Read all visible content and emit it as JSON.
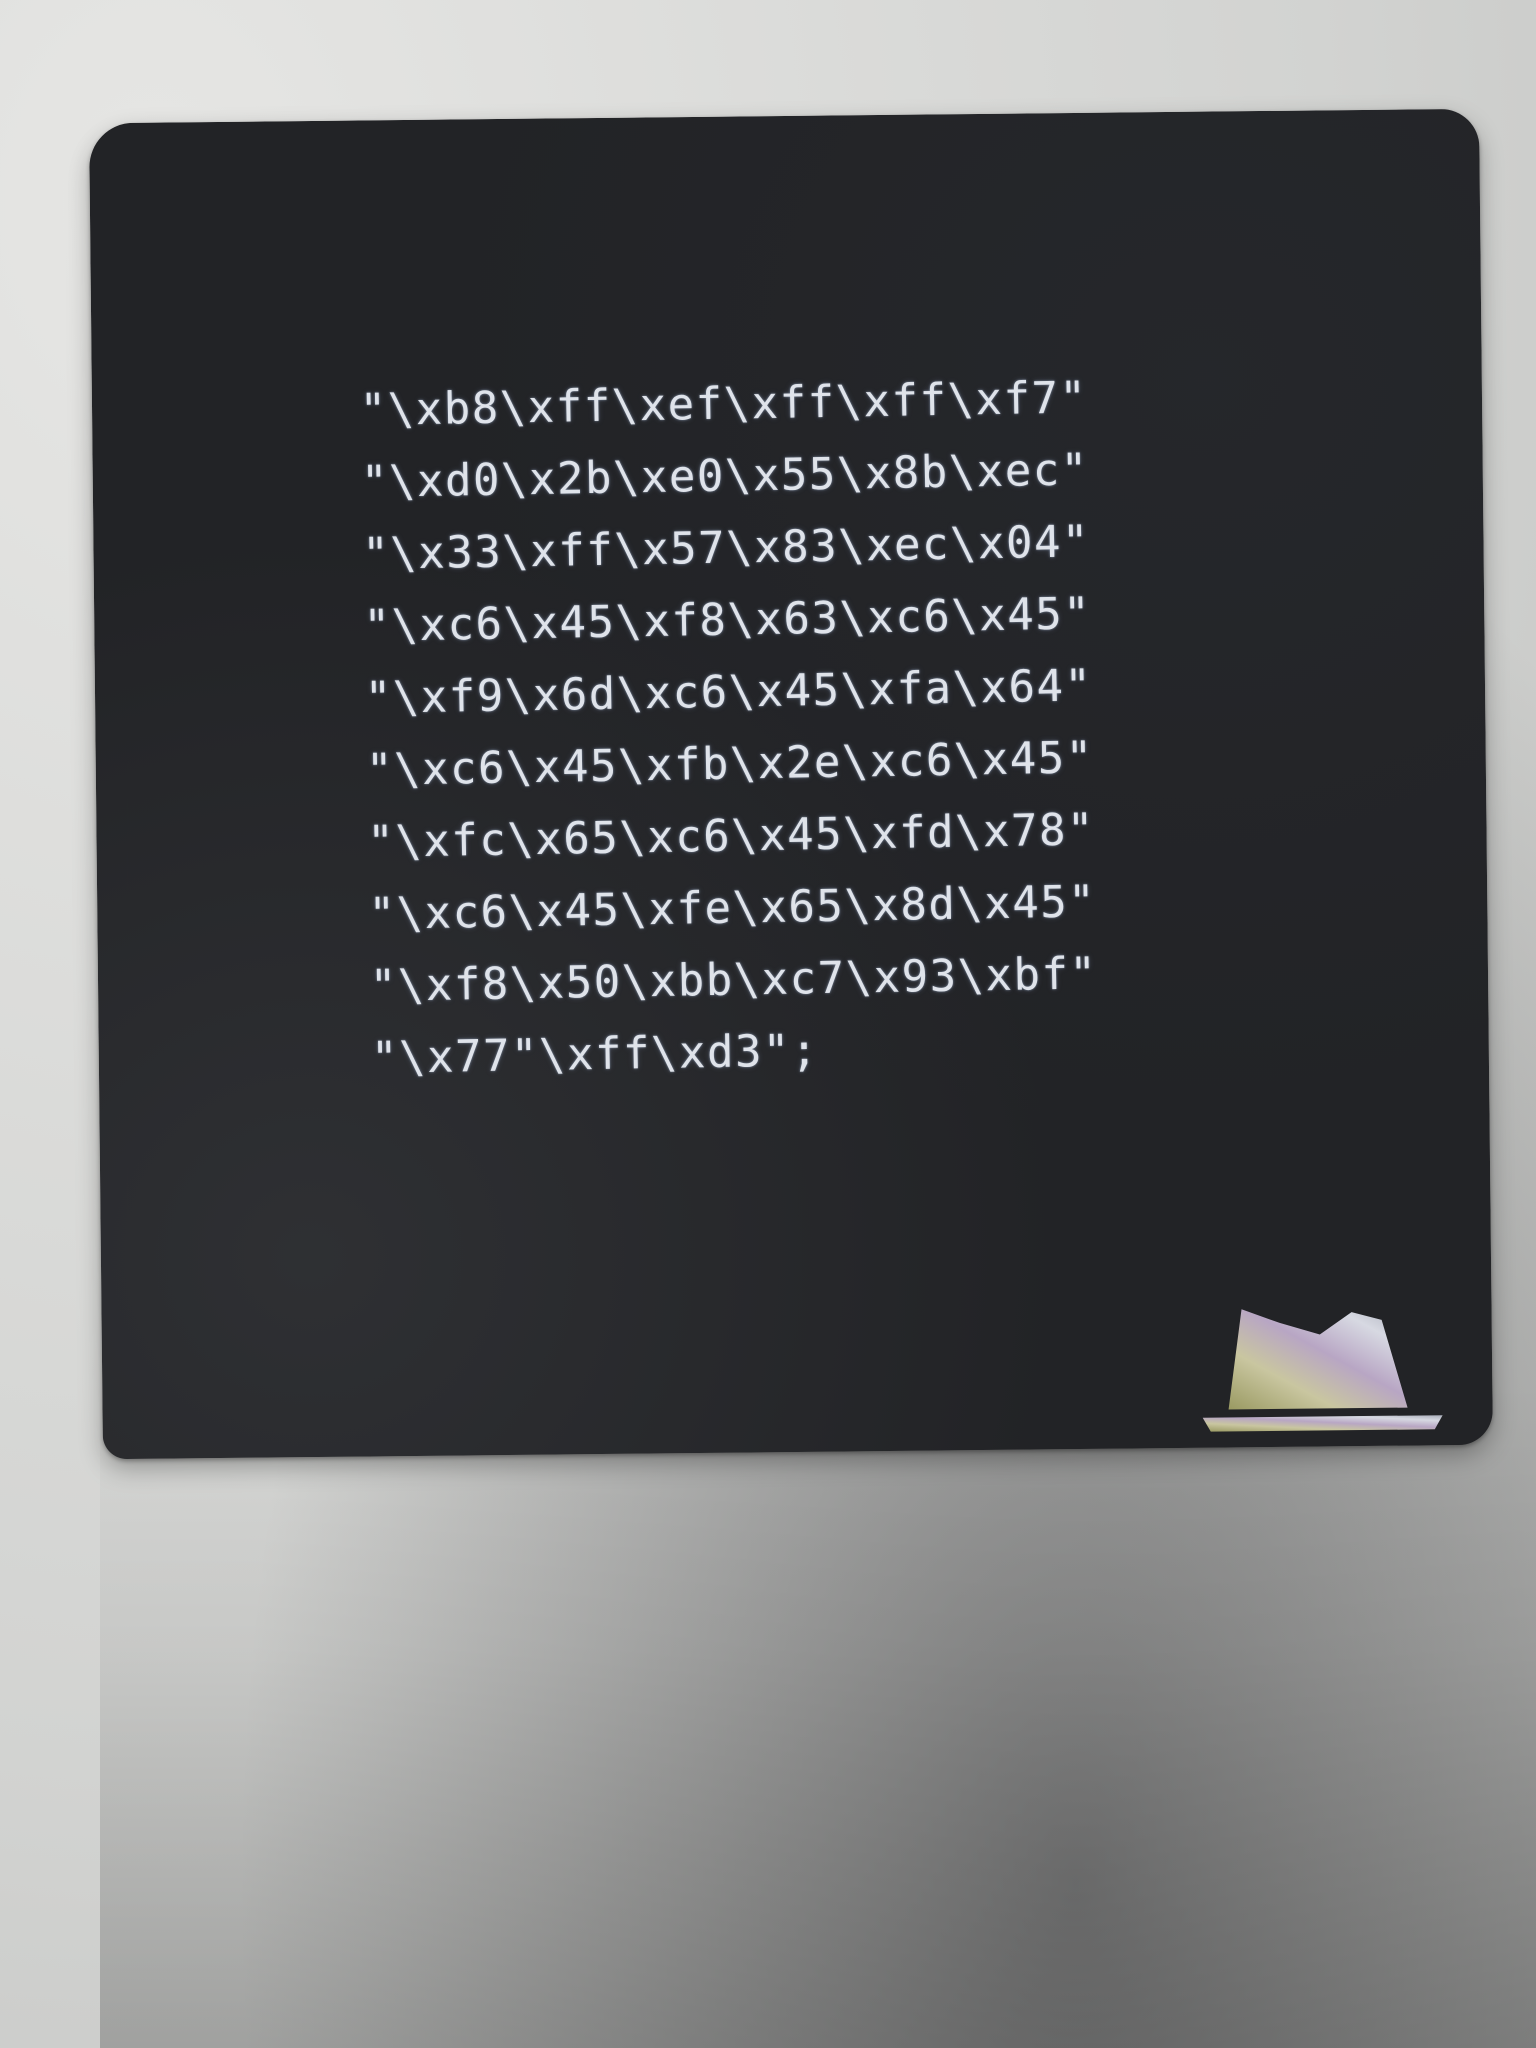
{
  "card": {
    "code_lines": [
      "\"\\xb8\\xff\\xef\\xff\\xff\\xf7\"",
      "\"\\xd0\\x2b\\xe0\\x55\\x8b\\xec\"",
      "\"\\x33\\xff\\x57\\x83\\xec\\x04\"",
      "\"\\xc6\\x45\\xf8\\x63\\xc6\\x45\"",
      "\"\\xf9\\x6d\\xc6\\x45\\xfa\\x64\"",
      "\"\\xc6\\x45\\xfb\\x2e\\xc6\\x45\"",
      "\"\\xfc\\x65\\xc6\\x45\\xfd\\x78\"",
      "\"\\xc6\\x45\\xfe\\x65\\x8d\\x45\"",
      "\"\\xf8\\x50\\xbb\\xc7\\x93\\xbf\"",
      "\"\\x77\"\\xff\\xd3\";"
    ],
    "logo_icon": "fedora-hat-icon"
  },
  "colors": {
    "card": "#222326",
    "foil_text": "#dfe3ea",
    "background": "#d2d3d1"
  }
}
